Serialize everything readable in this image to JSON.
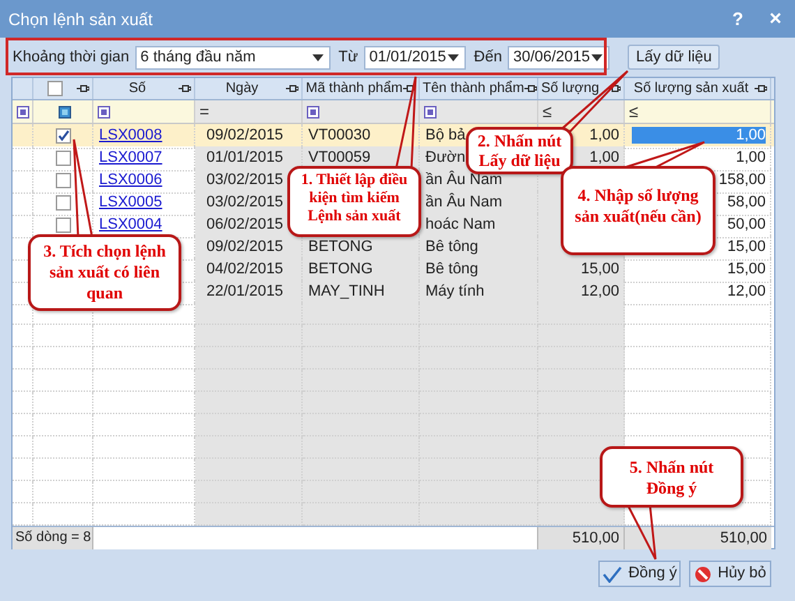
{
  "window": {
    "title": "Chọn lệnh sản xuất",
    "help": "?",
    "close": "×"
  },
  "filter_bar": {
    "period_label": "Khoảng thời gian",
    "period": "6 tháng đầu năm",
    "from_label": "Từ",
    "from": "01/01/2015",
    "to_label": "Đến",
    "to": "30/06/2015",
    "fetch_button": "Lấy dữ liệu"
  },
  "table": {
    "header_checkbox": {
      "checked": false
    },
    "columns": [
      "Số",
      "Ngày",
      "Mã thành phẩm",
      "Tên thành phẩm",
      "Số lượng",
      "Số lượng sản xuất"
    ],
    "filter_row": [
      {
        "kind": "icon"
      },
      {
        "kind": "select-icon"
      },
      {
        "kind": "icon"
      },
      {
        "kind": "text",
        "text": "="
      },
      {
        "kind": "icon"
      },
      {
        "kind": "icon"
      },
      {
        "kind": "text",
        "text": "≤"
      },
      {
        "kind": "text",
        "text": "≤"
      }
    ],
    "rows": [
      {
        "selected": true,
        "checked": true,
        "number": "LSX0008",
        "date": "09/02/2015",
        "product_code": "VT00030",
        "product_name": "Bộ bả",
        "quantity": "1,00",
        "production_quantity": "1,00"
      },
      {
        "selected": false,
        "checked": false,
        "number": "LSX0007",
        "date": "01/01/2015",
        "product_code": "VT00059",
        "product_name": "Đườn",
        "quantity": "1,00",
        "production_quantity": "1,00"
      },
      {
        "selected": false,
        "checked": false,
        "number": "LSX0006",
        "date": "03/02/2015",
        "product_name": "ần Âu Nam",
        "production_quantity": "158,00"
      },
      {
        "selected": false,
        "checked": false,
        "number": "LSX0005",
        "date": "03/02/2015",
        "product_name": "ần Âu Nam",
        "production_quantity": "58,00"
      },
      {
        "selected": false,
        "checked": false,
        "number": "LSX0004",
        "date": "06/02/2015",
        "product_name": "hoác Nam",
        "production_quantity": "50,00"
      },
      {
        "selected": false,
        "date": "09/02/2015",
        "product_code": "BETONG",
        "product_name": "Bê tông",
        "production_quantity": "15,00"
      },
      {
        "selected": false,
        "date": "04/02/2015",
        "product_code": "BETONG",
        "product_name": "Bê tông",
        "quantity": "15,00",
        "production_quantity": "15,00"
      },
      {
        "selected": false,
        "date": "22/01/2015",
        "product_code": "MAY_TINH",
        "product_name": "Máy tính",
        "quantity": "12,00",
        "production_quantity": "12,00"
      }
    ],
    "footer": {
      "row_count": "Số dòng = 8",
      "quantity_total": "510,00",
      "production_total": "510,00"
    }
  },
  "buttons": [
    {
      "kind": "ok",
      "label": "Đồng ý"
    },
    {
      "kind": "cancel",
      "label": "Hủy bỏ"
    }
  ],
  "callouts": [
    {
      "text": "1. Thiết lập điều kiện tìm kiếm Lệnh sản xuất"
    },
    {
      "text": "2. Nhấn nút Lấy dữ liệu"
    },
    {
      "text": "3. Tích chọn lệnh sản xuất có liên quan"
    },
    {
      "text": "4. Nhập số lượng sản xuất(nếu cần)"
    },
    {
      "text": "5. Nhấn nút Đồng ý"
    }
  ]
}
